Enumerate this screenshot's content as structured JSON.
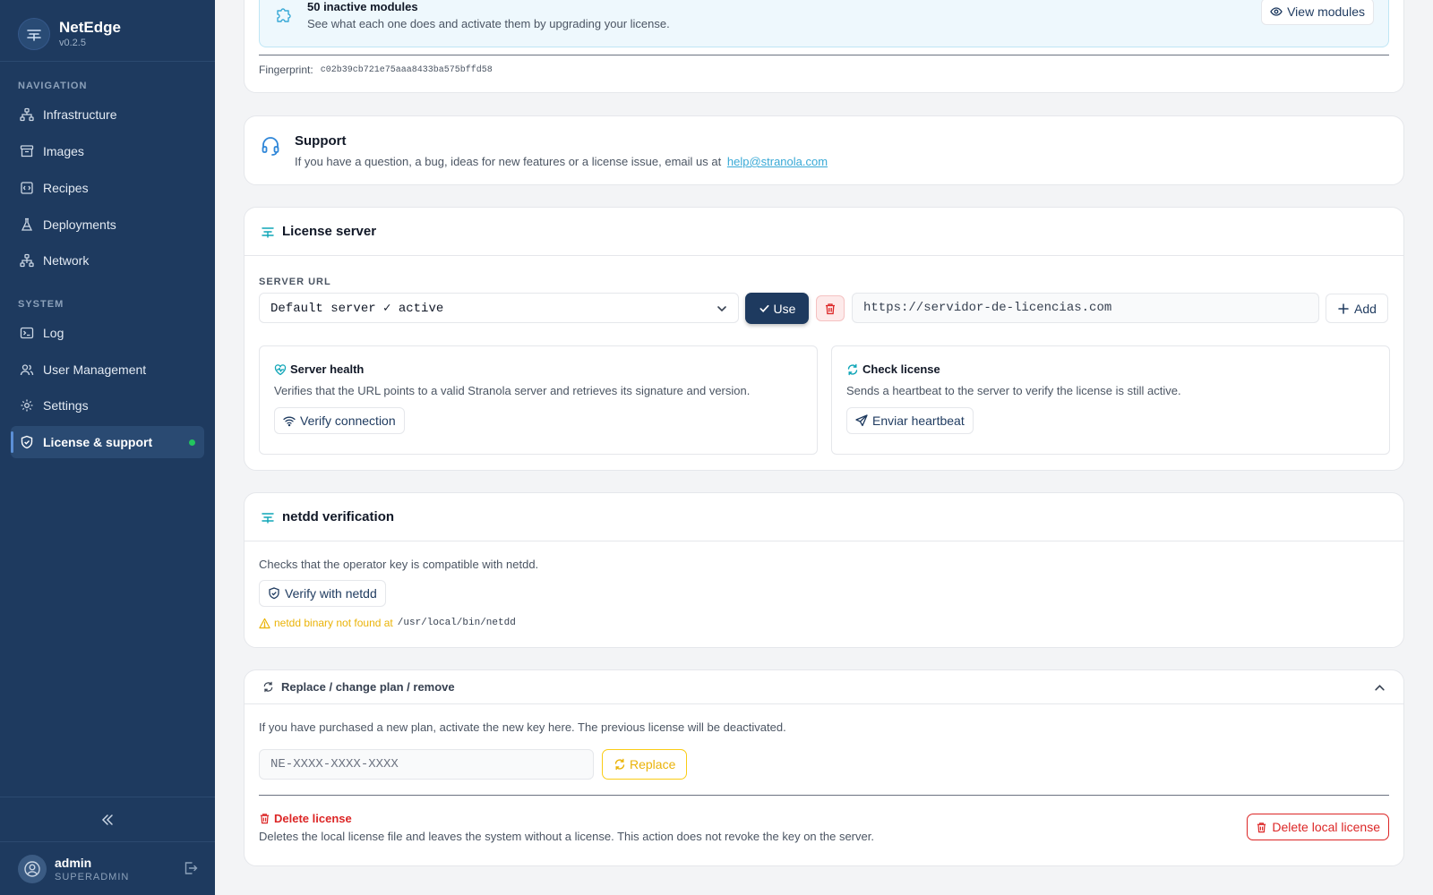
{
  "sidebar": {
    "brand_name": "NetEdge",
    "brand_version": "v0.2.5",
    "nav_section": "NAVIGATION",
    "nav_items": [
      {
        "label": "Infrastructure",
        "icon": "hierarchy-icon"
      },
      {
        "label": "Images",
        "icon": "archive-icon"
      },
      {
        "label": "Recipes",
        "icon": "recipe-icon"
      },
      {
        "label": "Deployments",
        "icon": "flask-icon"
      },
      {
        "label": "Network",
        "icon": "network-icon"
      }
    ],
    "system_section": "SYSTEM",
    "system_items": [
      {
        "label": "Log",
        "icon": "terminal-icon"
      },
      {
        "label": "User Management",
        "icon": "users-icon"
      },
      {
        "label": "Settings",
        "icon": "gear-icon"
      },
      {
        "label": "License & support",
        "icon": "shield-icon",
        "active": true
      }
    ],
    "user": {
      "name": "admin",
      "role": "SUPERADMIN"
    }
  },
  "modules_banner": {
    "title": "50 inactive modules",
    "description": "See what each one does and activate them by upgrading your license.",
    "button": "View modules",
    "fingerprint_label": "Fingerprint:",
    "fingerprint_value": "c02b39cb721e75aaa8433ba575bffd58"
  },
  "support": {
    "title": "Support",
    "text": "If you have a question, a bug, ideas for new features or a license issue, email us at",
    "email": "help@stranola.com"
  },
  "license_server": {
    "title": "License server",
    "server_url_label": "SERVER URL",
    "selected_server": "Default server ✓ active",
    "use_button": "Use",
    "url_input_value": "https://servidor-de-licencias.com",
    "add_button": "Add",
    "health": {
      "title": "Server health",
      "description": "Verifies that the URL points to a valid Stranola server and retrieves its signature and version.",
      "button": "Verify connection"
    },
    "check": {
      "title": "Check license",
      "description": "Sends a heartbeat to the server to verify the license is still active.",
      "button": "Enviar heartbeat"
    }
  },
  "netdd": {
    "title": "netdd verification",
    "description": "Checks that the operator key is compatible with netdd.",
    "button": "Verify with netdd",
    "warning_text": "netdd binary not found at",
    "warning_path": "/usr/local/bin/netdd"
  },
  "replace": {
    "title": "Replace / change plan / remove",
    "description": "If you have purchased a new plan, activate the new key here. The previous license will be deactivated.",
    "key_placeholder": "NE-XXXX-XXXX-XXXX",
    "replace_button": "Replace",
    "delete_title": "Delete license",
    "delete_description": "Deletes the local license file and leaves the system without a license. This action does not revoke the key on the server.",
    "delete_button": "Delete local license"
  },
  "colors": {
    "sidebar_bg": "#1e3a5f",
    "accent": "#1e3a5f",
    "info_bg": "#eef8fd",
    "teal": "#0ea5b7",
    "warning": "#eab308",
    "danger": "#dc2626",
    "success": "#22c55e"
  }
}
